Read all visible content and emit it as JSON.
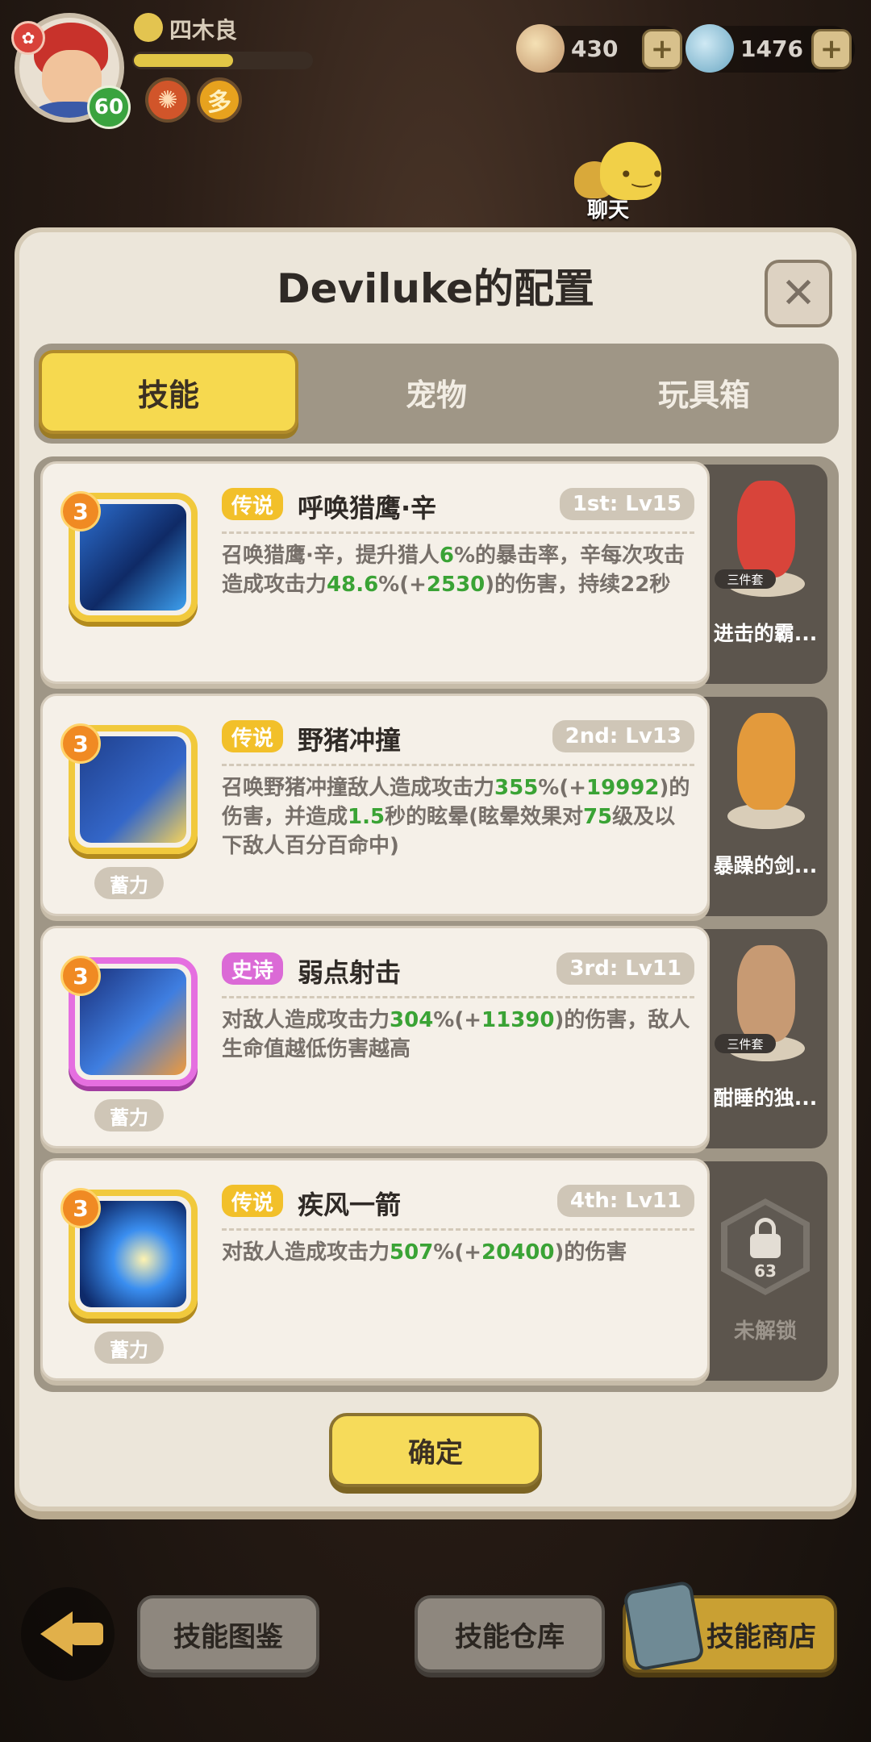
{
  "player": {
    "name": "四木良",
    "level": "60",
    "exp_progress": 0.56
  },
  "currency": [
    {
      "icon": "shell-icon",
      "value": "430"
    },
    {
      "icon": "gem-icon",
      "value": "1476"
    }
  ],
  "chat": {
    "label": "聊天"
  },
  "dialog": {
    "title": "Deviluke的配置",
    "close_icon": "close-icon",
    "tabs": [
      {
        "label": "技能",
        "active": true
      },
      {
        "label": "宠物",
        "active": false
      },
      {
        "label": "玩具箱",
        "active": false
      }
    ],
    "skills": [
      {
        "rank": "3",
        "rarity": "传说",
        "name": "呼唤猎鹰·辛",
        "slot": "1st: Lv15",
        "charge": "",
        "desc": [
          {
            "t": "召唤猎鹰·辛，提升猎人"
          },
          {
            "t": "6",
            "g": true
          },
          {
            "t": "%的暴击率，辛每次攻击造成攻击力"
          },
          {
            "t": "48.6",
            "g": true
          },
          {
            "t": "%(+"
          },
          {
            "t": "2530",
            "g": true
          },
          {
            "t": ")的伤害，持续22秒"
          }
        ],
        "side": {
          "name": "进击的霸...",
          "set": "三件套"
        }
      },
      {
        "rank": "3",
        "rarity": "传说",
        "name": "野猪冲撞",
        "slot": "2nd: Lv13",
        "charge": "蓄力",
        "desc": [
          {
            "t": "召唤野猪冲撞敌人造成攻击力"
          },
          {
            "t": "355",
            "g": true
          },
          {
            "t": "%(+"
          },
          {
            "t": "19992",
            "g": true
          },
          {
            "t": ")的伤害，并造成"
          },
          {
            "t": "1.5",
            "g": true
          },
          {
            "t": "秒的眩晕(眩晕效果对"
          },
          {
            "t": "75",
            "g": true
          },
          {
            "t": "级及以下敌人百分百命中)"
          }
        ],
        "side": {
          "name": "暴躁的剑...",
          "set": ""
        }
      },
      {
        "rank": "3",
        "rarity": "史诗",
        "name": "弱点射击",
        "slot": "3rd: Lv11",
        "charge": "蓄力",
        "desc": [
          {
            "t": "对敌人造成攻击力"
          },
          {
            "t": "304",
            "g": true
          },
          {
            "t": "%(+"
          },
          {
            "t": "11390",
            "g": true
          },
          {
            "t": ")的伤害，敌人生命值越低伤害越高"
          }
        ],
        "side": {
          "name": "酣睡的独...",
          "set": "三件套"
        }
      },
      {
        "rank": "3",
        "rarity": "传说",
        "name": "疾风一箭",
        "slot": "4th: Lv11",
        "charge": "蓄力",
        "desc": [
          {
            "t": "对敌人造成攻击力"
          },
          {
            "t": "507",
            "g": true
          },
          {
            "t": "%(+"
          },
          {
            "t": "20400",
            "g": true
          },
          {
            "t": ")的伤害"
          }
        ],
        "side": {
          "locked": true,
          "level": "63",
          "label": "未解锁"
        }
      }
    ],
    "confirm_label": "确定"
  },
  "bottom_bar": {
    "back_icon": "back-arrow-icon",
    "buttons": [
      "技能图鉴",
      "技能仓库",
      "技能商店"
    ]
  },
  "colors": {
    "legend": "#f2c02a",
    "epic": "#db6ad6",
    "highlight_green": "#3aa335",
    "active_tab": "#f6d94f"
  }
}
